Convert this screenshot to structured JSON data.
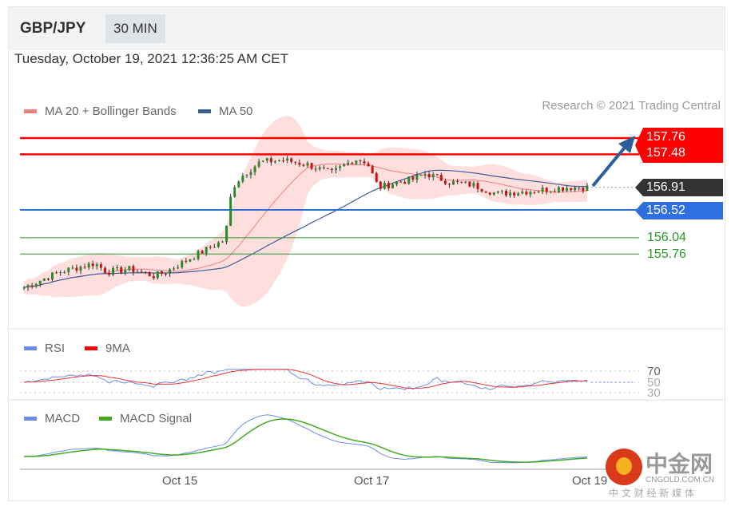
{
  "header": {
    "symbol": "GBP/JPY",
    "timeframe": "30 MIN"
  },
  "datetime": "Tuesday, October 19, 2021 12:36:25 AM CET",
  "legend": {
    "ma20": "MA 20 + Bollinger Bands",
    "ma50": "MA 50",
    "credit": "Research © 2021 Trading Central"
  },
  "levels": {
    "r2": "157.76",
    "r1": "157.48",
    "last": "156.91",
    "pivot": "156.52",
    "s1": "156.04",
    "s2": "155.76"
  },
  "rsi": {
    "label": "RSI",
    "ma_label": "9MA",
    "l70": "70",
    "l50": "50",
    "l30": "30"
  },
  "macd": {
    "label": "MACD",
    "signal_label": "MACD Signal"
  },
  "xaxis": [
    "Oct 15",
    "Oct 17",
    "Oct 19"
  ],
  "watermark": {
    "name": "中金网",
    "domain": "CNGOLD.COM.CN",
    "tagline": "中 文 财 经 新 媒 体"
  },
  "colors": {
    "red": "#ff0000",
    "blue": "#2f6fe0",
    "green": "#2a9a2a",
    "dark": "#333333",
    "ma50": "#3a5d96",
    "ma20": "#f08080",
    "band": "#ffd6d6"
  },
  "chart_data": {
    "type": "candlestick",
    "price_path": [
      [
        0,
        155.18
      ],
      [
        15,
        155.45
      ],
      [
        20,
        155.5
      ],
      [
        30,
        155.6
      ],
      [
        35,
        155.45
      ],
      [
        45,
        155.5
      ],
      [
        55,
        155.38
      ],
      [
        60,
        155.45
      ],
      [
        70,
        155.68
      ],
      [
        80,
        155.9
      ],
      [
        85,
        156.0
      ],
      [
        88,
        156.9
      ],
      [
        92,
        157.1
      ],
      [
        100,
        157.35
      ],
      [
        110,
        157.38
      ],
      [
        120,
        157.3
      ],
      [
        130,
        157.15
      ],
      [
        140,
        157.4
      ],
      [
        145,
        157.35
      ],
      [
        150,
        156.9
      ],
      [
        158,
        157.0
      ],
      [
        165,
        157.05
      ],
      [
        170,
        157.15
      ],
      [
        180,
        157.0
      ],
      [
        190,
        156.95
      ],
      [
        200,
        156.8
      ],
      [
        215,
        156.85
      ],
      [
        230,
        156.91
      ],
      [
        240,
        156.91
      ]
    ],
    "candles": 140,
    "horizontal_levels": [
      157.76,
      157.48,
      156.91,
      156.52,
      156.04,
      155.76
    ],
    "x_ticks": [
      "Oct 15",
      "Oct 17",
      "Oct 19"
    ]
  }
}
